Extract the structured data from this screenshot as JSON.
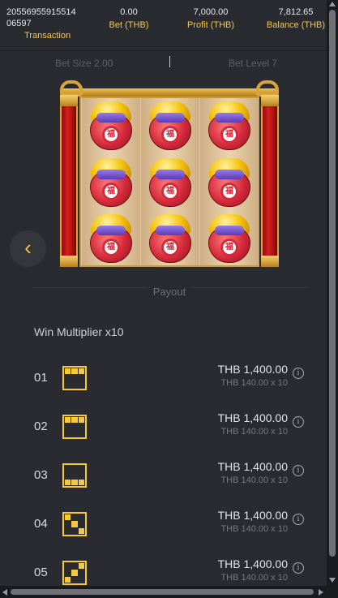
{
  "summary": {
    "transaction": {
      "value": "2055695591551406597",
      "label": "Transaction"
    },
    "bet": {
      "value": "0.00",
      "label": "Bet (THB)"
    },
    "profit": {
      "value": "7,000.00",
      "label": "Profit (THB)"
    },
    "balance": {
      "value": "7,812.65",
      "label": "Balance (THB)"
    }
  },
  "bet_info": {
    "bet_size": "Bet Size 2.00",
    "bet_level": "Bet Level 7"
  },
  "reels": {
    "symbol": "fortune-bag-icon",
    "coin_glyph": "福",
    "columns": 3,
    "rows": 3
  },
  "payout": {
    "title": "Payout",
    "win_multiplier": "Win Multiplier x10",
    "lines": [
      {
        "num": "01",
        "pattern": [
          1,
          1,
          1,
          0,
          0,
          0,
          0,
          0,
          0
        ],
        "amount": "THB 1,400.00",
        "calc": "THB 140.00 x 10"
      },
      {
        "num": "02",
        "pattern": [
          1,
          1,
          1,
          0,
          0,
          0,
          0,
          0,
          0
        ],
        "amount": "THB 1,400.00",
        "calc": "THB 140.00 x 10"
      },
      {
        "num": "03",
        "pattern": [
          0,
          0,
          0,
          0,
          0,
          0,
          1,
          1,
          1
        ],
        "amount": "THB 1,400.00",
        "calc": "THB 140.00 x 10"
      },
      {
        "num": "04",
        "pattern": [
          1,
          0,
          0,
          0,
          1,
          0,
          0,
          0,
          1
        ],
        "amount": "THB 1,400.00",
        "calc": "THB 140.00 x 10"
      },
      {
        "num": "05",
        "pattern": [
          0,
          0,
          1,
          0,
          1,
          0,
          1,
          0,
          0
        ],
        "amount": "THB 1,400.00",
        "calc": "THB 140.00 x 10"
      }
    ]
  },
  "colors": {
    "accent": "#f5c842",
    "background": "#2a2b31"
  },
  "icons": {
    "prev": "chevron-left-icon",
    "info": "info-icon"
  }
}
